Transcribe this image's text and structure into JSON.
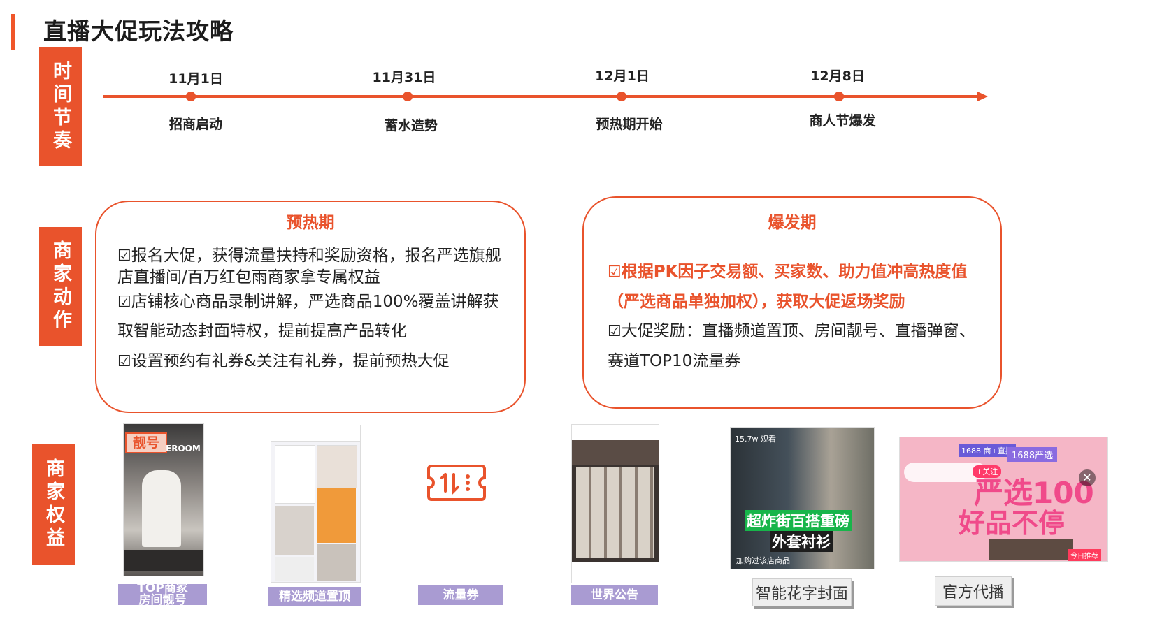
{
  "page": {
    "title": "直播大促玩法攻略"
  },
  "side_labels": {
    "rhythm": "时间节奏",
    "actions": "商家动作",
    "benefits": "商家权益"
  },
  "timeline": [
    {
      "date": "11月1日",
      "event": "招商启动"
    },
    {
      "date": "11月31日",
      "event": "蓄水造势"
    },
    {
      "date": "12月1日",
      "event": "预热期开始"
    },
    {
      "date": "12月8日",
      "event": "商人节爆发"
    }
  ],
  "panels": {
    "preheat": {
      "title": "预热期",
      "bullets": [
        {
          "line1": "报名大促，获得流量扶持和奖励资格，报名严选旗舰",
          "line2": "店直播间/百万红包雨商家拿专属权益"
        },
        {
          "line1": "店铺核心商品录制讲解，严选商品100%覆盖讲解获",
          "line2": "取智能动态封面特权，提前提高产品转化"
        },
        {
          "line1": "设置预约有礼券&关注有礼券，提前预热大促",
          "line2": ""
        }
      ]
    },
    "burst": {
      "title": "爆发期",
      "bullets": [
        {
          "line1": "根据PK因子交易额、买家数、助力值冲高热度值",
          "line2": "（严选商品单独加权），获取大促返场奖励"
        },
        {
          "line1": "大促奖励：直播频道置顶、房间靓号、直播弹窗、",
          "line2": "赛道TOP10流量券"
        }
      ]
    },
    "checkbox_glyph": "☑"
  },
  "benefits": [
    {
      "caption_line1": "TOP商家",
      "caption_line2": "房间靓号",
      "badge": "靓号",
      "badge2": "EROOM"
    },
    {
      "caption_line1": "精选频道置顶",
      "caption_line2": ""
    },
    {
      "caption_line1": "流量券",
      "caption_line2": ""
    },
    {
      "caption_line1": "世界公告",
      "caption_line2": ""
    },
    {
      "caption_line1": "智能花字封面",
      "caption_line2": "",
      "overlay_views": "15.7w 观看",
      "overlay_line1": "超炸街百搭重磅",
      "overlay_line2": "外套衬衫",
      "overlay_foot": "加购过该店商品"
    },
    {
      "caption_line1": "官方代播",
      "caption_line2": "",
      "overlay_top1": "1688 商+直播",
      "overlay_top2": "1688严选",
      "overlay_big1": "严选100",
      "overlay_big2": "好品不停",
      "overlay_follow": "+关注",
      "overlay_tag": "今日推荐"
    }
  ],
  "colors": {
    "accent": "#e9532c",
    "caption_purple": "#a99bd2"
  }
}
